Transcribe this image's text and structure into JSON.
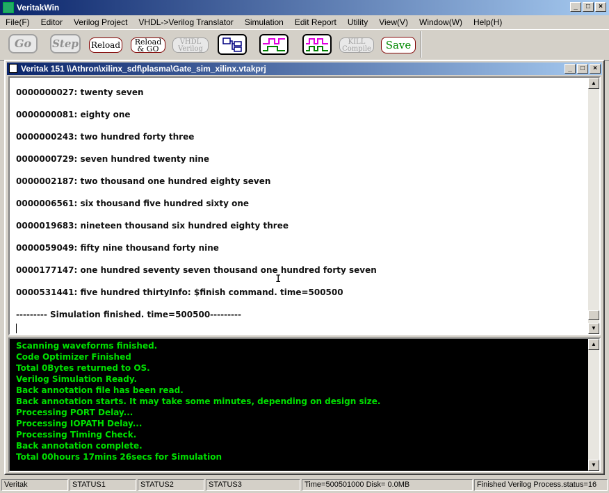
{
  "window": {
    "title": "VeritakWin"
  },
  "menu": [
    "File(F)",
    "Editor",
    "Verilog Project",
    "VHDL->Verilog Translator",
    "Simulation",
    "Edit Report",
    "Utility",
    "View(V)",
    "Window(W)",
    "Help(H)"
  ],
  "toolbar": {
    "go": "Go",
    "step": "Step",
    "reload": "Reload",
    "reload_go_1": "Reload",
    "reload_go_2": "& GO",
    "vhdl_1": "VHDL",
    "vhdl_2": "Verilog",
    "kill_1": "KILL",
    "kill_2": "Compile",
    "save": "Save",
    "icons": [
      "hierarchy-icon",
      "waveform-icon",
      "waveform-dual-icon"
    ],
    "colors": {
      "wave_top": "#e000e0",
      "wave_bottom": "#008000",
      "save_text": "#008000"
    }
  },
  "child_window": {
    "title": "Veritak 151 \\\\Athron\\xilinx_sdf\\plasma\\Gate_sim_xilinx.vtakprj"
  },
  "output_lines": [
    "0000000027: twenty seven",
    "0000000081: eighty one",
    "0000000243: two hundred forty three",
    "0000000729: seven hundred twenty nine",
    "0000002187: two thousand one hundred eighty seven",
    "0000006561: six thousand five hundred sixty one",
    "0000019683: nineteen thousand six hundred eighty three",
    "0000059049: fifty nine thousand forty nine",
    "0000177147: one hundred seventy seven thousand one hundred forty seven",
    "0000531441: five hundred thirtyInfo: $finish command. time=500500",
    "--------- Simulation finished. time=500500---------"
  ],
  "console_lines": [
    "Scanning waveforms finished.",
    "Code Optimizer Finished",
    "Total 0Bytes returned to OS.",
    "Verilog Simulation Ready.",
    "Back annotation file has been read.",
    "Back annotation starts. It may take some minutes, depending on design size.",
    "Processing PORT Delay...",
    "Processing IOPATH Delay...",
    "Processing Timing Check.",
    "Back annotation complete.",
    "Total  00hours 17mins 26secs for Simulation"
  ],
  "console_color": "#00e000",
  "status": {
    "app": "Veritak",
    "s1": "STATUS1",
    "s2": "STATUS2",
    "s3": "STATUS3",
    "time_disk": "Time=500501000 Disk= 0.0MB",
    "process": "Finished Verilog Process.status=16"
  }
}
